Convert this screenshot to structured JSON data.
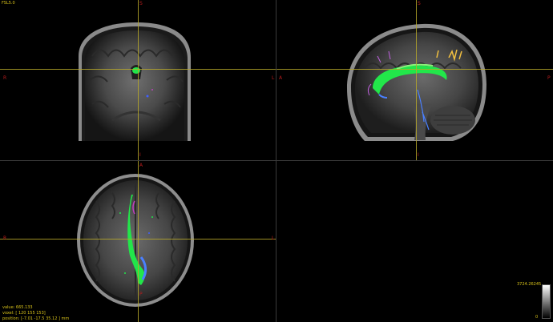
{
  "app": {
    "title": "FSL5.0"
  },
  "views": {
    "coronal": {
      "labels": {
        "top": "S",
        "bottom": "I",
        "left": "R",
        "right": "L"
      }
    },
    "sagittal": {
      "labels": {
        "top": "S",
        "bottom": "I",
        "left": "A",
        "right": "P"
      }
    },
    "axial": {
      "labels": {
        "top": "A",
        "bottom": "P",
        "left": "R",
        "right": "L"
      }
    }
  },
  "status": {
    "value": "value: 665.133",
    "voxel": "voxel: [ 120 155 153]",
    "position": "position: [-7.01 -17.5 35.12 ] mm"
  },
  "colorbar": {
    "max": "3724.26245",
    "min": "0"
  },
  "colors": {
    "crosshair": "#b7a82a",
    "text": "#d8c21a",
    "orientation": "#b71c1c",
    "tract": "#22e64a"
  }
}
